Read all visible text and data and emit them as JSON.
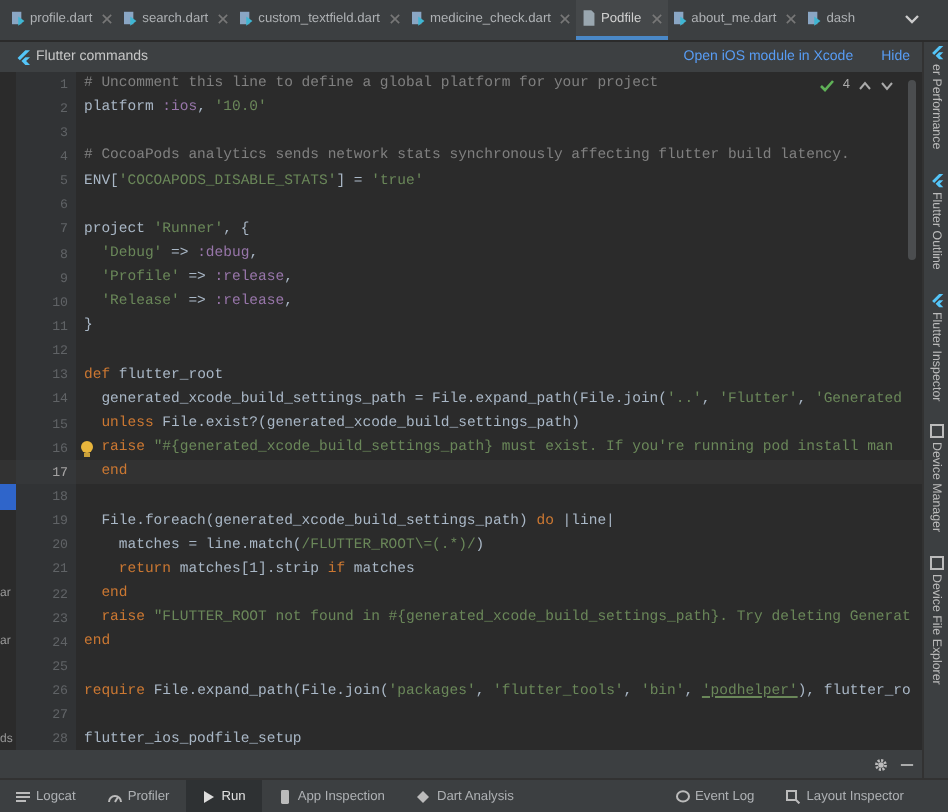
{
  "tabs": [
    {
      "label": "profile.dart",
      "kind": "dart",
      "selected": false
    },
    {
      "label": "search.dart",
      "kind": "dart",
      "selected": false
    },
    {
      "label": "custom_textfield.dart",
      "kind": "dart",
      "selected": false
    },
    {
      "label": "medicine_check.dart",
      "kind": "dart",
      "selected": false
    },
    {
      "label": "Podfile",
      "kind": "file",
      "selected": true
    },
    {
      "label": "about_me.dart",
      "kind": "dart",
      "selected": false
    },
    {
      "label": "dash",
      "kind": "dart",
      "selected": false
    }
  ],
  "commands_bar": {
    "title": "Flutter commands",
    "links": [
      "Open iOS module in Xcode",
      "Hide"
    ]
  },
  "inspection": {
    "count": "4"
  },
  "lines": [
    {
      "number": "1",
      "tokens": [
        {
          "kind": "comment",
          "text": "# Uncomment this line to define a global platform for your project"
        }
      ]
    },
    {
      "number": "2",
      "tokens": [
        {
          "kind": "plain",
          "text": "platform "
        },
        {
          "kind": "symbol",
          "text": ":ios"
        },
        {
          "kind": "plain",
          "text": ", "
        },
        {
          "kind": "string",
          "text": "'10.0'"
        }
      ]
    },
    {
      "number": "3"
    },
    {
      "number": "4",
      "tokens": [
        {
          "kind": "comment",
          "text": "# CocoaPods analytics sends network stats synchronously affecting flutter build latency."
        }
      ]
    },
    {
      "number": "5",
      "tokens": [
        {
          "kind": "plain",
          "text": "ENV["
        },
        {
          "kind": "string",
          "text": "'COCOAPODS_DISABLE_STATS'"
        },
        {
          "kind": "plain",
          "text": "] = "
        },
        {
          "kind": "string",
          "text": "'true'"
        }
      ]
    },
    {
      "number": "6"
    },
    {
      "number": "7",
      "tokens": [
        {
          "kind": "plain",
          "text": "project "
        },
        {
          "kind": "string",
          "text": "'Runner'"
        },
        {
          "kind": "plain",
          "text": ", {"
        }
      ]
    },
    {
      "number": "8",
      "tokens": [
        {
          "kind": "string",
          "text": "  'Debug'"
        },
        {
          "kind": "plain",
          "text": " => "
        },
        {
          "kind": "symbol",
          "text": ":debug"
        },
        {
          "kind": "plain",
          "text": ","
        }
      ]
    },
    {
      "number": "9",
      "tokens": [
        {
          "kind": "string",
          "text": "  'Profile'"
        },
        {
          "kind": "plain",
          "text": " => "
        },
        {
          "kind": "symbol",
          "text": ":release"
        },
        {
          "kind": "plain",
          "text": ","
        }
      ]
    },
    {
      "number": "10",
      "tokens": [
        {
          "kind": "string",
          "text": "  'Release'"
        },
        {
          "kind": "plain",
          "text": " => "
        },
        {
          "kind": "symbol",
          "text": ":release"
        },
        {
          "kind": "plain",
          "text": ","
        }
      ]
    },
    {
      "number": "11",
      "tokens": [
        {
          "kind": "plain",
          "text": "}"
        }
      ]
    },
    {
      "number": "12"
    },
    {
      "number": "13",
      "tokens": [
        {
          "kind": "keyword",
          "text": "def"
        },
        {
          "kind": "plain",
          "text": " flutter_root"
        }
      ]
    },
    {
      "number": "14",
      "tokens": [
        {
          "kind": "plain",
          "text": "  generated_xcode_build_settings_path = File.expand_path(File.join("
        },
        {
          "kind": "string",
          "text": "'..'"
        },
        {
          "kind": "plain",
          "text": ", "
        },
        {
          "kind": "string",
          "text": "'Flutter'"
        },
        {
          "kind": "plain",
          "text": ", "
        },
        {
          "kind": "string",
          "text": "'Generated"
        }
      ]
    },
    {
      "number": "15",
      "tokens": [
        {
          "kind": "keyword",
          "text": "  unless"
        },
        {
          "kind": "plain",
          "text": " File.exist?(generated_xcode_build_settings_path)"
        }
      ]
    },
    {
      "number": "16",
      "hint": true,
      "tokens": [
        {
          "kind": "keyword",
          "text": "  raise"
        },
        {
          "kind": "string",
          "text": " \"#{generated_xcode_build_settings_path} must exist. If you're running pod install man"
        }
      ]
    },
    {
      "number": "17",
      "current": true,
      "tokens": [
        {
          "kind": "keyword",
          "text": "  end"
        }
      ]
    },
    {
      "number": "18",
      "marked": true
    },
    {
      "number": "19",
      "tokens": [
        {
          "kind": "plain",
          "text": "  File.foreach(generated_xcode_build_settings_path) "
        },
        {
          "kind": "keyword",
          "text": "do"
        },
        {
          "kind": "plain",
          "text": " |line|"
        }
      ]
    },
    {
      "number": "20",
      "tokens": [
        {
          "kind": "plain",
          "text": "    matches = line.match("
        },
        {
          "kind": "string",
          "text": "/FLUTTER_ROOT\\=(.*)/"
        },
        {
          "kind": "plain",
          "text": ")"
        }
      ]
    },
    {
      "number": "21",
      "tokens": [
        {
          "kind": "keyword",
          "text": "    return"
        },
        {
          "kind": "plain",
          "text": " matches[1].strip "
        },
        {
          "kind": "keyword",
          "text": "if"
        },
        {
          "kind": "plain",
          "text": " matches"
        }
      ]
    },
    {
      "number": "22",
      "side": "ar",
      "tokens": [
        {
          "kind": "keyword",
          "text": "  end"
        }
      ]
    },
    {
      "number": "23",
      "tokens": [
        {
          "kind": "keyword",
          "text": "  raise"
        },
        {
          "kind": "string",
          "text": " \"FLUTTER_ROOT not found in #{generated_xcode_build_settings_path}. Try deleting Generat"
        }
      ]
    },
    {
      "number": "24",
      "side": "ar",
      "tokens": [
        {
          "kind": "keyword",
          "text": "end"
        }
      ]
    },
    {
      "number": "25"
    },
    {
      "number": "26",
      "tokens": [
        {
          "kind": "keyword",
          "text": "require"
        },
        {
          "kind": "plain",
          "text": " File.expand_path(File.join("
        },
        {
          "kind": "string",
          "text": "'packages'"
        },
        {
          "kind": "plain",
          "text": ", "
        },
        {
          "kind": "string",
          "text": "'flutter_tools'"
        },
        {
          "kind": "plain",
          "text": ", "
        },
        {
          "kind": "string",
          "text": "'bin'"
        },
        {
          "kind": "plain",
          "text": ", "
        },
        {
          "kind": "link",
          "text": "'podhelper'"
        },
        {
          "kind": "plain",
          "text": "), flutter_ro"
        }
      ]
    },
    {
      "number": "27"
    },
    {
      "number": "28",
      "side": "ds",
      "tokens": [
        {
          "kind": "plain",
          "text": "flutter_ios_podfile_setup"
        }
      ]
    }
  ],
  "right_tools": [
    {
      "label": "er Performance",
      "kind": "flutter"
    },
    {
      "label": "Flutter Outline",
      "kind": "flutter"
    },
    {
      "label": "Flutter Inspector",
      "kind": "flutter"
    },
    {
      "label": "Device Manager",
      "kind": "device"
    },
    {
      "label": "Device File Explorer",
      "kind": "device"
    }
  ],
  "bottom_tools": [
    {
      "label": "Logcat",
      "kind": "logcat",
      "selected": false
    },
    {
      "label": "Profiler",
      "kind": "profiler",
      "selected": false
    },
    {
      "label": "Run",
      "kind": "run",
      "selected": true
    },
    {
      "label": "App Inspection",
      "kind": "inspection",
      "selected": false
    },
    {
      "label": "Dart Analysis",
      "kind": "analysis",
      "selected": false
    }
  ],
  "bottom_right_tools": [
    {
      "label": "Event Log",
      "kind": "event"
    },
    {
      "label": "Layout Inspector",
      "kind": "layout"
    }
  ]
}
